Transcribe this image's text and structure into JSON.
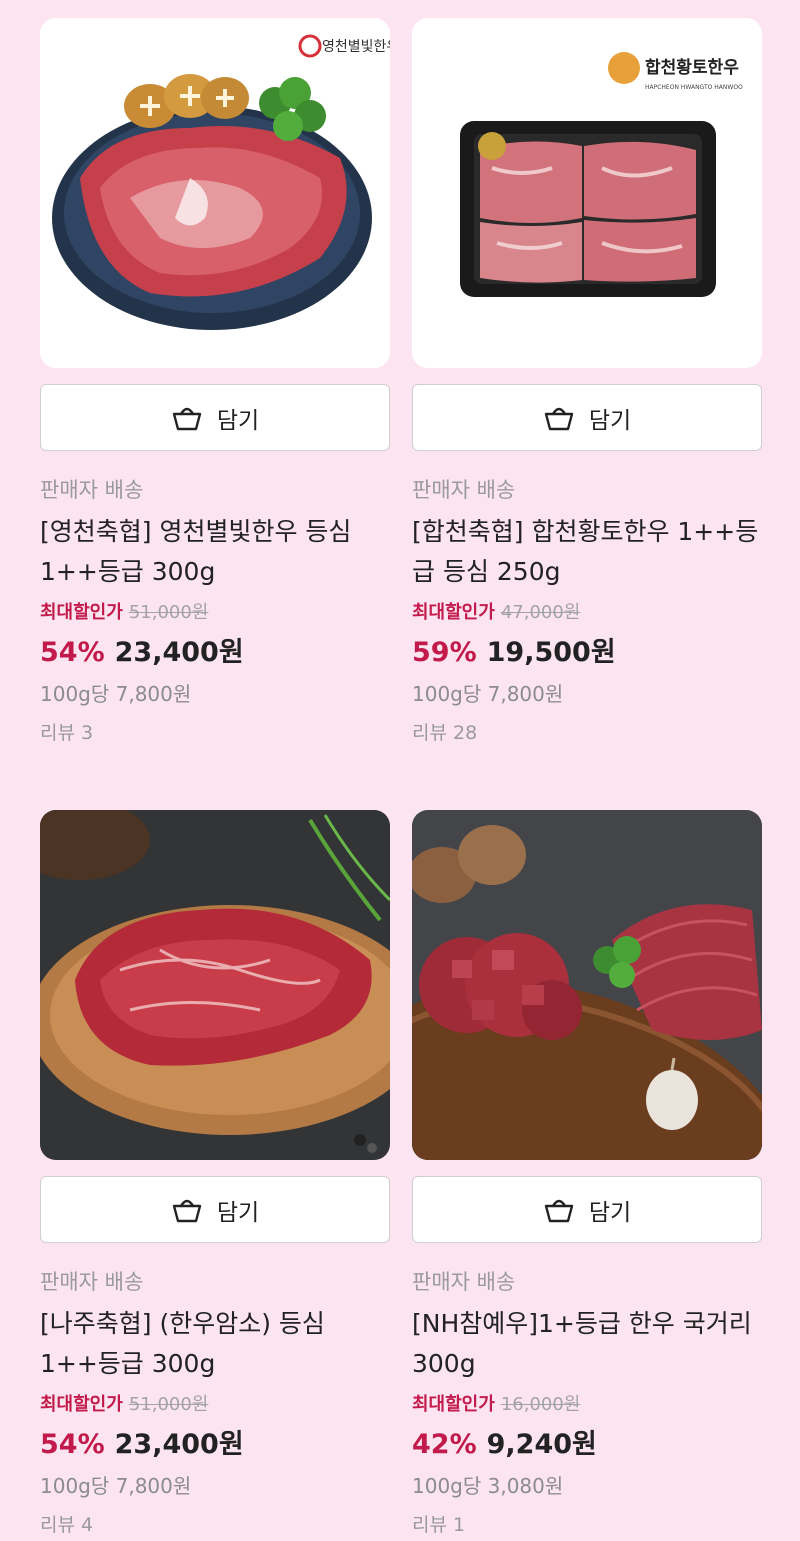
{
  "products": [
    {
      "seller_label": "판매자 배송",
      "title": "[영천축협] 영천별빛한우 등심 1++등급 300g",
      "discount_label": "최대할인가",
      "original_price": "51,000원",
      "discount_percent": "54%",
      "price": "23,400원",
      "unit_price": "100g당 7,800원",
      "reviews": "리뷰 3",
      "cart_label": "담기",
      "image_kind": "ribeye-plate",
      "logo_text": "영천별빛한우"
    },
    {
      "seller_label": "판매자 배송",
      "title": "[합천축협] 합천황토한우 1++등급 등심 250g",
      "discount_label": "최대할인가",
      "original_price": "47,000원",
      "discount_percent": "59%",
      "price": "19,500원",
      "unit_price": "100g당 7,800원",
      "reviews": "리뷰 28",
      "cart_label": "담기",
      "image_kind": "packaged-beef",
      "logo_text": "합천황토한우",
      "logo_subtext": "HAPCHEON HWANGTO HANWOO"
    },
    {
      "seller_label": "판매자 배송",
      "title": "[나주축협] (한우암소) 등심 1++등급 300g",
      "discount_label": "최대할인가",
      "original_price": "51,000원",
      "discount_percent": "54%",
      "price": "23,400원",
      "unit_price": "100g당 7,800원",
      "reviews": "리뷰 4",
      "cart_label": "담기",
      "image_kind": "steak-wood-plate"
    },
    {
      "seller_label": "판매자 배송",
      "title": "[NH참예우]1+등급 한우 국거리 300g",
      "discount_label": "최대할인가",
      "original_price": "16,000원",
      "discount_percent": "42%",
      "price": "9,240원",
      "unit_price": "100g당 3,080원",
      "reviews": "리뷰 1",
      "cart_label": "담기",
      "image_kind": "cubed-beef-board"
    }
  ],
  "colors": {
    "background": "#fce4f1",
    "accent": "#c21a4b",
    "muted": "#9a9a9a"
  },
  "icons": {
    "cart": "shopping-basket-icon"
  }
}
